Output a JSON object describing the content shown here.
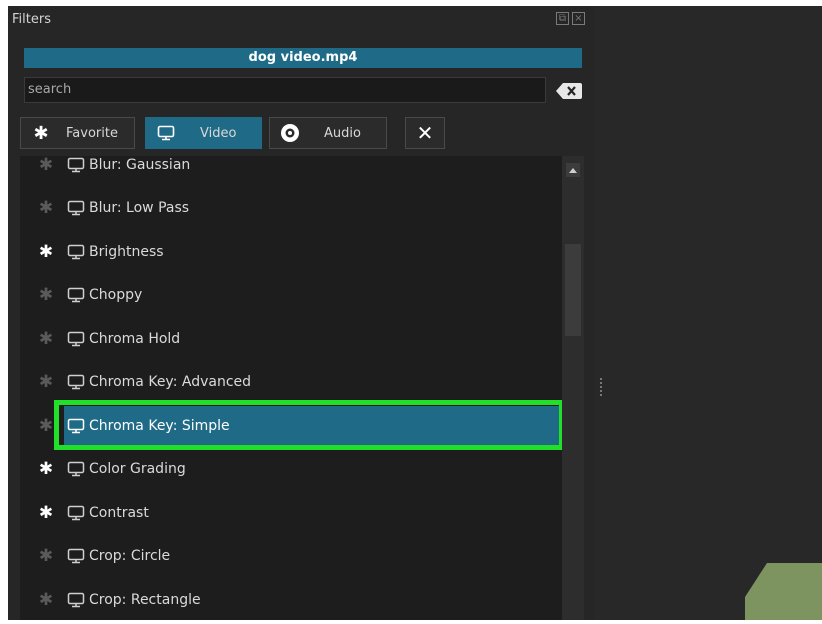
{
  "panel": {
    "title": "Filters"
  },
  "file": {
    "name": "dog video.mp4"
  },
  "search": {
    "value": "search"
  },
  "tabs": [
    {
      "label": "Favorite",
      "icon": "star-icon"
    },
    {
      "label": "Video",
      "icon": "monitor-icon",
      "active": true
    },
    {
      "label": "Audio",
      "icon": "speaker-icon"
    }
  ],
  "filters": [
    {
      "name": "Blur: Gaussian",
      "favorite": false
    },
    {
      "name": "Blur: Low Pass",
      "favorite": false
    },
    {
      "name": "Brightness",
      "favorite": true
    },
    {
      "name": "Choppy",
      "favorite": false
    },
    {
      "name": "Chroma Hold",
      "favorite": false
    },
    {
      "name": "Chroma Key: Advanced",
      "favorite": false
    },
    {
      "name": "Chroma Key: Simple",
      "favorite": false,
      "selected": true
    },
    {
      "name": "Color Grading",
      "favorite": true
    },
    {
      "name": "Contrast",
      "favorite": true
    },
    {
      "name": "Crop: Circle",
      "favorite": false
    },
    {
      "name": "Crop: Rectangle",
      "favorite": false
    }
  ],
  "colors": {
    "accent": "#1f6b87",
    "highlight": "#22e02a",
    "panel_bg": "#262626",
    "list_bg": "#1d1d1d",
    "corner_shape": "#7d9460"
  }
}
